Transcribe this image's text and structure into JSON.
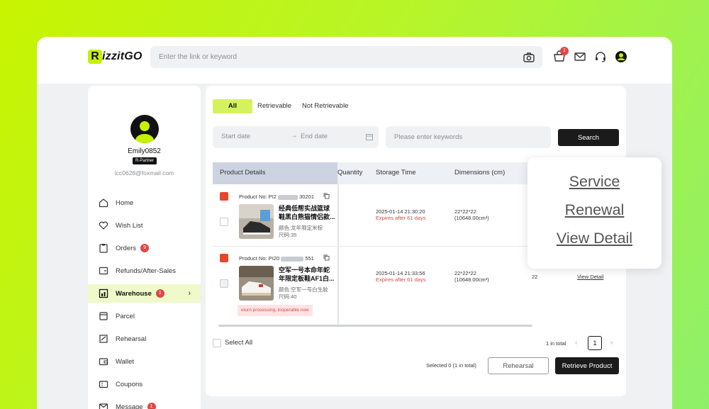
{
  "colors": {
    "accent": "#d5f25e",
    "danger": "#e04646",
    "dark": "#1b1b1b"
  },
  "header": {
    "logo_mark": "R",
    "logo_text": "izzitGO",
    "search_placeholder": "Enter the link or keyword",
    "cart_count": "1",
    "icons": [
      "camera-icon",
      "cart-icon",
      "mail-icon",
      "headset-icon",
      "user-icon"
    ]
  },
  "sidebar": {
    "username": "Emily0852",
    "tier": "R-Partner",
    "email": "lcc0628@foxmail.com",
    "items": [
      {
        "label": "Home",
        "icon": "home-icon"
      },
      {
        "label": "Wish List",
        "icon": "heart-icon"
      },
      {
        "label": "Orders",
        "icon": "clipboard-icon",
        "badge": "9"
      },
      {
        "label": "Refunds/After-Sales",
        "icon": "refund-icon"
      },
      {
        "label": "Warehouse",
        "icon": "warehouse-icon",
        "badge": "1",
        "active": true
      },
      {
        "label": "Parcel",
        "icon": "parcel-icon"
      },
      {
        "label": "Rehearsal",
        "icon": "rehearsal-icon"
      },
      {
        "label": "Wallet",
        "icon": "wallet-icon"
      },
      {
        "label": "Coupons",
        "icon": "coupon-icon"
      },
      {
        "label": "Message",
        "icon": "message-icon",
        "badge": "1"
      }
    ]
  },
  "tabs": [
    "All",
    "Retrievable",
    "Not Retrievable"
  ],
  "filters": {
    "start_placeholder": "Start date",
    "arrow": "→",
    "end_placeholder": "End date",
    "keyword_placeholder": "Please enter keywords",
    "search_label": "Search"
  },
  "table": {
    "columns": [
      "Product Details",
      "Quantity",
      "Storage Time",
      "Dimensions (cm)"
    ],
    "rows": [
      {
        "product_no_prefix": "Product No: PI2",
        "product_no_suffix": "30201",
        "title": "经典低帮实战篮球鞋黑白熊猫情侣款...",
        "spec1": "颜色:龙年限定米棕",
        "spec2": "尺码:35",
        "storage_time": "2025-01-14 21:30:20",
        "expires": "Expires after 61 days",
        "dims": "22*22*22",
        "volume": "(10648.00cm³)"
      },
      {
        "product_no_prefix": "Product No: PI20",
        "product_no_suffix": "551",
        "title": "空军一号本命年蛇年限定板鞋AF1白...",
        "spec1": "颜色:空军一号白生胶",
        "spec2": "尺码:40",
        "storage_time": "2025-01-14 21:33:56",
        "expires": "Expires after 61 days",
        "dims": "22*22*22",
        "volume": "(10648.00cm³)",
        "qty": "22",
        "view_detail": "View Detail",
        "warning": "eturn processing, inoperable now"
      }
    ]
  },
  "footer": {
    "select_all": "Select All",
    "total": "1 in total",
    "page": "1",
    "prev": "‹",
    "next": "›",
    "selected": "Selected 0 (1 in total)",
    "rehearsal_btn": "Rehearsal",
    "retrieve_btn": "Retrieve Product"
  },
  "popup": {
    "items": [
      "Service",
      "Renewal",
      "View Detail"
    ]
  }
}
